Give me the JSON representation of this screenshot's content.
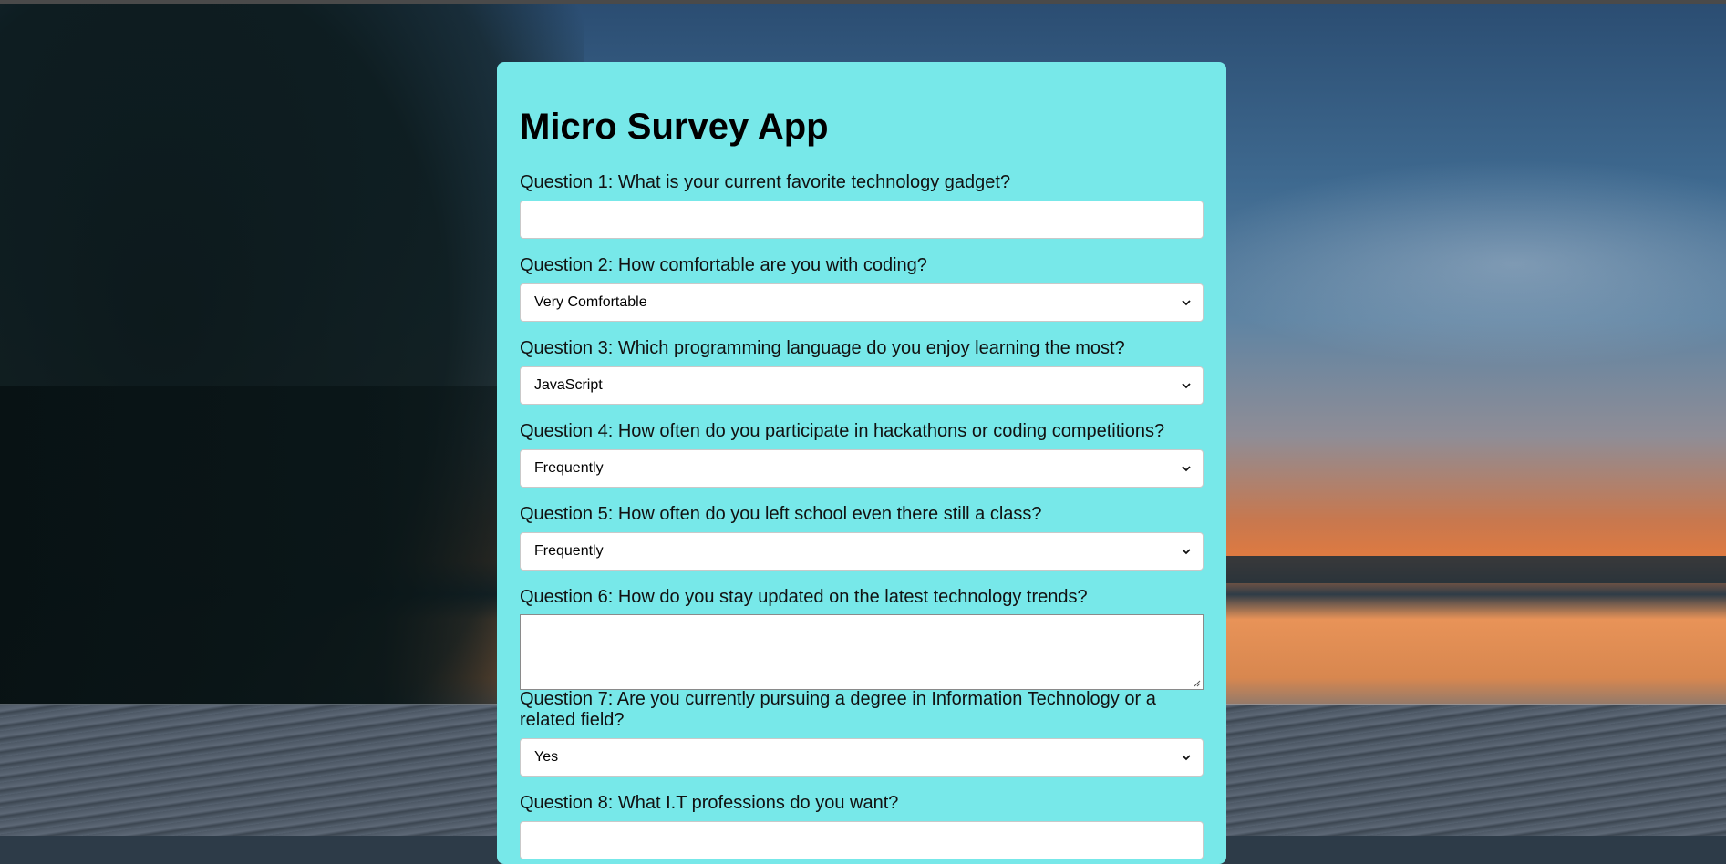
{
  "app": {
    "title": "Micro Survey App"
  },
  "questions": [
    {
      "label": "Question 1: What is your current favorite technology gadget?",
      "type": "text",
      "value": ""
    },
    {
      "label": "Question 2: How comfortable are you with coding?",
      "type": "select",
      "value": "Very Comfortable"
    },
    {
      "label": "Question 3: Which programming language do you enjoy learning the most?",
      "type": "select",
      "value": "JavaScript"
    },
    {
      "label": "Question 4: How often do you participate in hackathons or coding competitions?",
      "type": "select",
      "value": "Frequently"
    },
    {
      "label": "Question 5: How often do you left school even there still a class?",
      "type": "select",
      "value": "Frequently"
    },
    {
      "label": "Question 6: How do you stay updated on the latest technology trends?",
      "type": "textarea",
      "value": ""
    },
    {
      "label": "Question 7: Are you currently pursuing a degree in Information Technology or a related field?",
      "type": "select",
      "value": "Yes"
    },
    {
      "label": "Question 8: What I.T professions do you want?",
      "type": "text",
      "value": ""
    }
  ],
  "colors": {
    "card_background": "#77e8e9",
    "input_background": "#ffffff"
  },
  "icons": {
    "select_arrow": "chevron-down-icon",
    "resize_handle": "resize-grip-icon"
  }
}
